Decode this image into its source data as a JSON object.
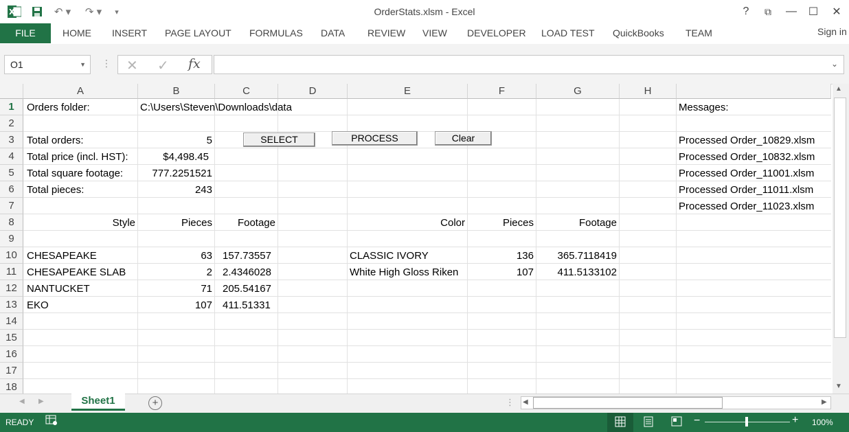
{
  "window": {
    "title": "OrderStats.xlsm - Excel",
    "sign_in": "Sign in",
    "help": "?",
    "minimize": "—",
    "restore": "❐",
    "close": "✕"
  },
  "ribbon": {
    "file": "FILE",
    "tabs": [
      "HOME",
      "INSERT",
      "PAGE LAYOUT",
      "FORMULAS",
      "DATA",
      "REVIEW",
      "VIEW",
      "DEVELOPER",
      "LOAD TEST",
      "QuickBooks",
      "TEAM"
    ]
  },
  "formula_bar": {
    "name_box": "O1",
    "fx": "fx",
    "formula": ""
  },
  "columns": [
    "A",
    "B",
    "C",
    "D",
    "E",
    "F",
    "G",
    "H",
    ""
  ],
  "rows": [
    "1",
    "2",
    "3",
    "4",
    "5",
    "6",
    "7",
    "8",
    "9",
    "10",
    "11",
    "12",
    "13",
    "14",
    "15",
    "16",
    "17",
    "18"
  ],
  "cells": {
    "A1": "Orders folder:",
    "B1": "C:\\Users\\Steven\\Downloads\\data",
    "I1": "Messages:",
    "A3": "Total orders:",
    "B3": "5",
    "A4": "Total price (incl. HST):",
    "B4": "$4,498.45",
    "A5": "Total square footage:",
    "B5": "777.2251521",
    "A6": "Total pieces:",
    "B6": "243",
    "I3": "Processed Order_10829.xlsm",
    "I4": "Processed Order_10832.xlsm",
    "I5": "Processed Order_11001.xlsm",
    "I6": "Processed Order_11011.xlsm",
    "I7": "Processed Order_11023.xlsm",
    "A8": "Style",
    "B8": "Pieces",
    "C8": "Footage",
    "E8": "Color",
    "F8": "Pieces",
    "G8": "Footage",
    "A10": "CHESAPEAKE",
    "B10": "63",
    "C10": "157.73557",
    "E10": "CLASSIC IVORY",
    "F10": "136",
    "G10": "365.7118419",
    "A11": "CHESAPEAKE SLAB",
    "B11": "2",
    "C11": "2.4346028",
    "E11": "White High Gloss Riken",
    "F11": "107",
    "G11": "411.5133102",
    "A12": "NANTUCKET",
    "B12": "71",
    "C12": "205.54167",
    "A13": "EKO",
    "B13": "107",
    "C13": "411.51331"
  },
  "buttons": {
    "select": "SELECT",
    "process": "PROCESS",
    "clear": "Clear"
  },
  "sheet_tabs": {
    "active": "Sheet1",
    "add": "+"
  },
  "status": {
    "ready": "READY",
    "zoom": "100%"
  },
  "colors": {
    "accent": "#217346"
  }
}
